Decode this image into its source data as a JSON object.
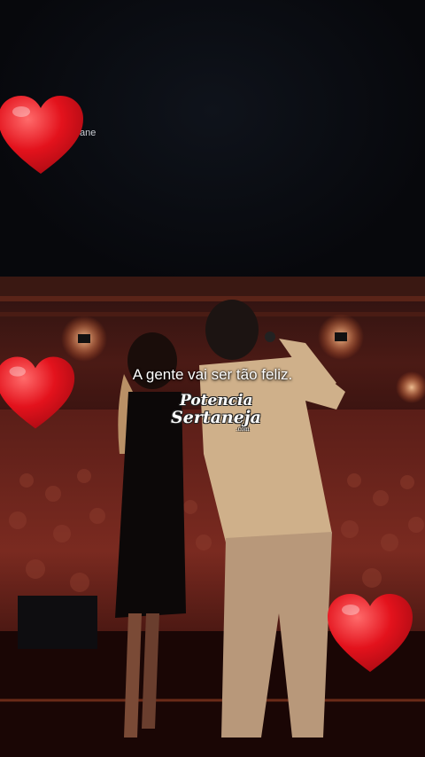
{
  "overlay": {
    "corner_text": "ane",
    "caption": "A gente vai ser tão feliz.",
    "watermark_line1": "Potencia",
    "watermark_line2": "Sertaneja",
    "watermark_domain": ".com"
  },
  "icons": [
    "heart-icon",
    "heart-icon",
    "heart-icon"
  ],
  "colors": {
    "heart": "#e3121c",
    "background": "#07080c",
    "stage_light": "#ff7a3a"
  }
}
